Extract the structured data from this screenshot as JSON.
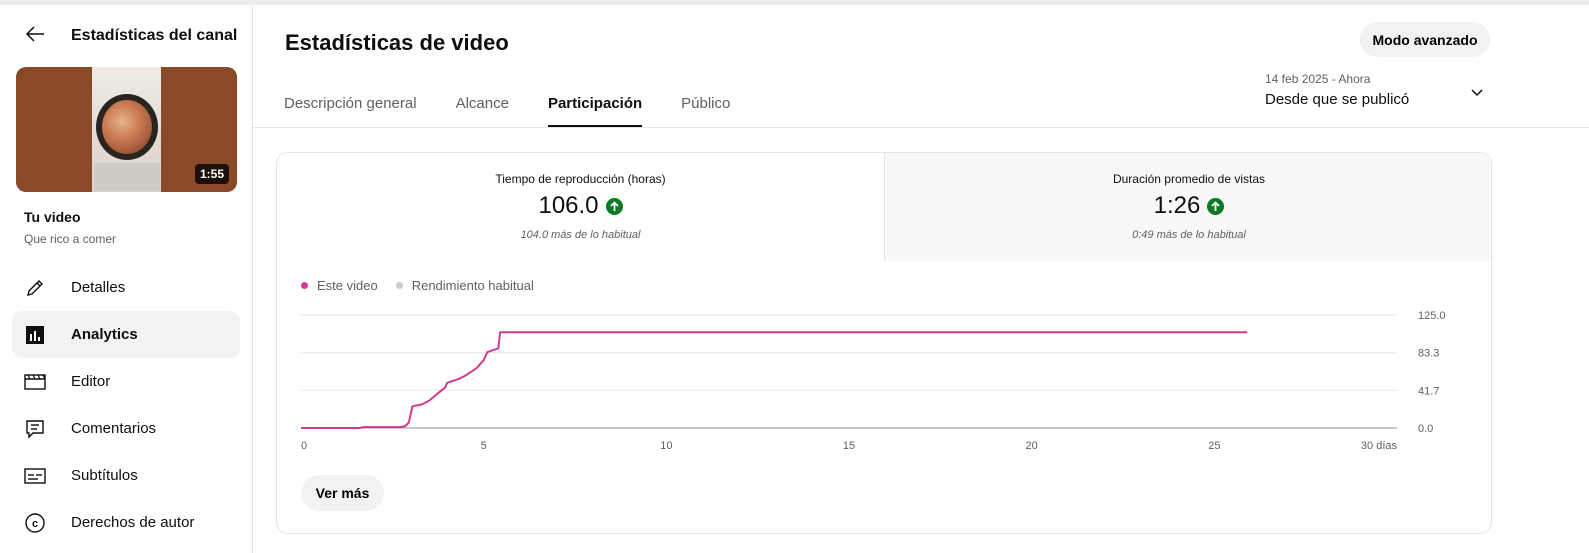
{
  "sidebar": {
    "title": "Estadísticas del canal",
    "video_duration": "1:55",
    "your_video_label": "Tu video",
    "video_title": "Que rico a comer",
    "items": [
      {
        "label": "Detalles",
        "icon": "pencil-icon"
      },
      {
        "label": "Analytics",
        "icon": "analytics-icon",
        "active": true
      },
      {
        "label": "Editor",
        "icon": "clapperboard-icon"
      },
      {
        "label": "Comentarios",
        "icon": "comment-icon"
      },
      {
        "label": "Subtítulos",
        "icon": "subtitles-icon"
      },
      {
        "label": "Derechos de autor",
        "icon": "copyright-icon"
      }
    ]
  },
  "header": {
    "title": "Estadísticas de video",
    "advanced_button": "Modo avanzado"
  },
  "tabs": [
    "Descripción general",
    "Alcance",
    "Participación",
    "Público"
  ],
  "active_tab": 2,
  "date_range": {
    "dates": "14 feb 2025 - Ahora",
    "label": "Desde que se publicó"
  },
  "metrics": [
    {
      "label": "Tiempo de reproducción (horas)",
      "value": "106.0",
      "note": "104.0 más de lo habitual"
    },
    {
      "label": "Duración promedio de vistas",
      "value": "1:26",
      "note": "0:49 más de lo habitual"
    }
  ],
  "legend": [
    {
      "label": "Este video",
      "color": "#d03b94"
    },
    {
      "label": "Rendimiento habitual",
      "color": "#cccccc"
    }
  ],
  "more_button": "Ver más",
  "chart_data": {
    "type": "line",
    "x_ticks": [
      "0",
      "5",
      "10",
      "15",
      "20",
      "25",
      "30 días"
    ],
    "y_ticks": [
      "125.0",
      "83.3",
      "41.7",
      "0.0"
    ],
    "ylim": [
      0,
      125
    ],
    "xlim": [
      0,
      30
    ],
    "series": [
      {
        "name": "Este video",
        "color": "#d03b94",
        "points": [
          [
            0,
            0
          ],
          [
            1.6,
            0
          ],
          [
            1.7,
            1
          ],
          [
            2.7,
            1
          ],
          [
            2.85,
            2
          ],
          [
            2.95,
            6
          ],
          [
            3.05,
            24
          ],
          [
            3.3,
            26
          ],
          [
            3.5,
            30
          ],
          [
            3.8,
            40
          ],
          [
            3.95,
            45
          ],
          [
            4.0,
            50
          ],
          [
            4.3,
            54
          ],
          [
            4.5,
            58
          ],
          [
            4.8,
            66
          ],
          [
            5.0,
            75
          ],
          [
            5.1,
            84
          ],
          [
            5.4,
            88
          ],
          [
            5.45,
            106
          ],
          [
            25.9,
            106
          ]
        ]
      }
    ]
  }
}
